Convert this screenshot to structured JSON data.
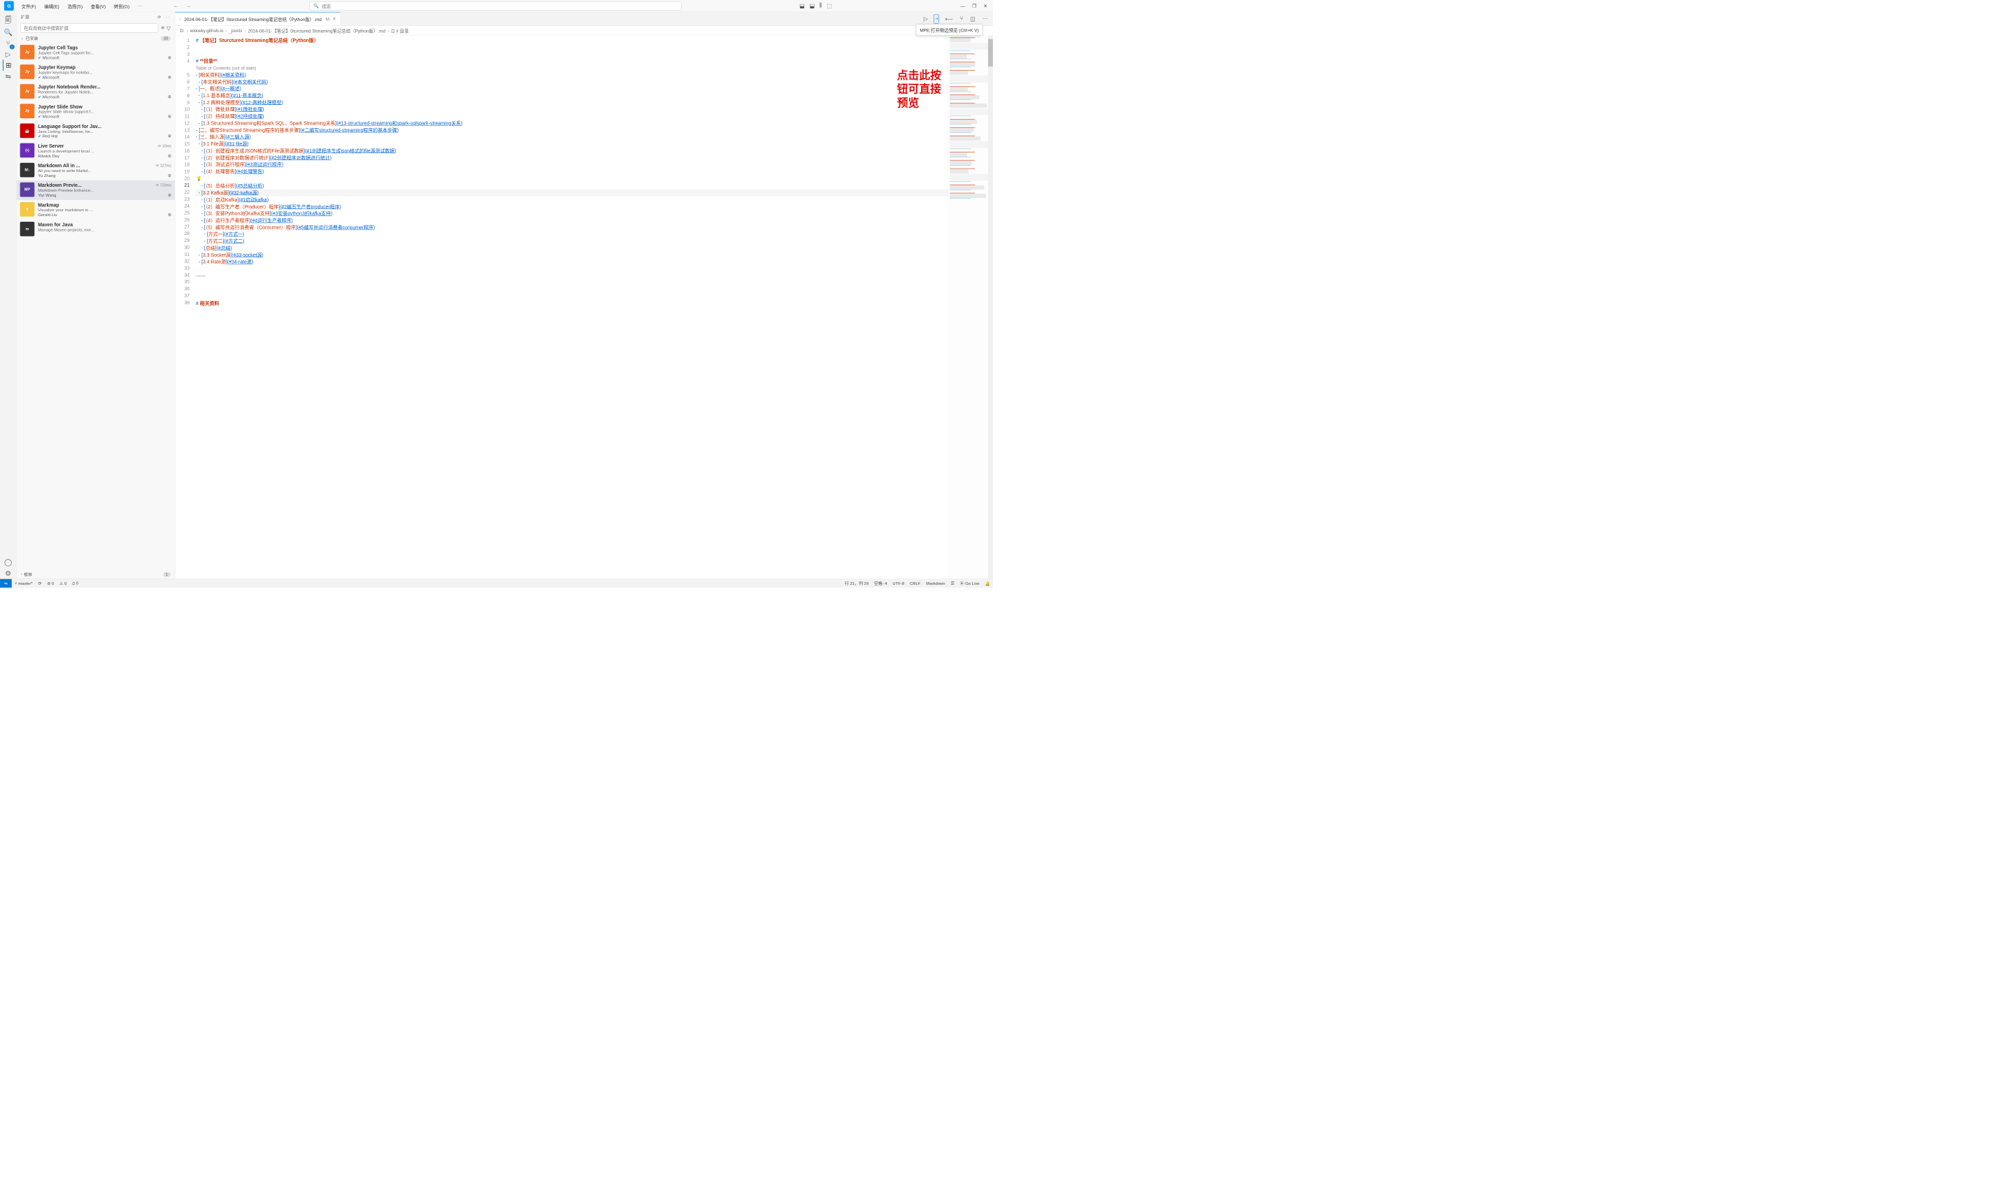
{
  "menu": [
    "文件(F)",
    "编辑(E)",
    "选择(S)",
    "查看(V)",
    "转到(G)",
    "···"
  ],
  "search_placeholder": "搜索",
  "titlebar_layouts": [
    "⬓",
    "⬓",
    "⫼",
    "⬚"
  ],
  "win_controls": [
    "—",
    "❐",
    "✕"
  ],
  "activity_icons": [
    {
      "name": "files-icon",
      "glyph": "🗐"
    },
    {
      "name": "search-icon",
      "glyph": "🔍"
    },
    {
      "name": "scm-icon",
      "glyph": "⑂",
      "badge": "1"
    },
    {
      "name": "debug-icon",
      "glyph": "▷"
    },
    {
      "name": "extensions-icon",
      "glyph": "⊞",
      "active": true
    },
    {
      "name": "remote-icon",
      "glyph": "⇋"
    }
  ],
  "activity_bottom": [
    {
      "name": "account-icon",
      "glyph": "◯"
    },
    {
      "name": "settings-icon",
      "glyph": "⚙"
    }
  ],
  "sidebar": {
    "title": "扩展",
    "search_placeholder": "在应用商店中搜索扩展",
    "installed_label": "已安装",
    "installed_count": "33",
    "recommended_label": "推荐",
    "recommended_count": "1",
    "items": [
      {
        "name": "Jupyter Cell Tags",
        "desc": "Jupyter Cell Tags support for...",
        "publisher": "Microsoft",
        "verified": true,
        "color": "#f37726",
        "icon": "Jy",
        "gear": true,
        "truncated": true
      },
      {
        "name": "Jupyter Keymap",
        "desc": "Jupyter keymaps for notebo...",
        "publisher": "Microsoft",
        "verified": true,
        "color": "#f37726",
        "icon": "Jy",
        "gear": true
      },
      {
        "name": "Jupyter Notebook Render...",
        "desc": "Renderers for Jupyter Noteb...",
        "publisher": "Microsoft",
        "verified": true,
        "color": "#f37726",
        "icon": "Jy",
        "gear": true
      },
      {
        "name": "Jupyter Slide Show",
        "desc": "Jupyter Slide Show support f...",
        "publisher": "Microsoft",
        "verified": true,
        "color": "#f37726",
        "icon": "Jy",
        "gear": true
      },
      {
        "name": "Language Support for Jav...",
        "desc": "Java Linting, Intellisense, for...",
        "publisher": "Red Hat",
        "verified": true,
        "color": "#cc0000",
        "icon": "☕",
        "gear": true
      },
      {
        "name": "Live Server",
        "desc": "Launch a development local ...",
        "publisher": "Ritwick Dey",
        "verified": false,
        "color": "#6c2eb9",
        "icon": "(•)",
        "time": "⟳ 10ms",
        "gear": true
      },
      {
        "name": "Markdown All in ...",
        "desc": "All you need to write Markd...",
        "publisher": "Yu Zhang",
        "verified": false,
        "color": "#333",
        "icon": "M↓",
        "time": "⟳ 127ms",
        "gear": true
      },
      {
        "name": "Markdown Previe...",
        "desc": "Markdown Preview Enhance...",
        "publisher": "Yiyi Wang",
        "verified": false,
        "color": "#5a3ea0",
        "icon": "MP",
        "time": "⟳ 733ms",
        "selected": true,
        "gear": true
      },
      {
        "name": "Markmap",
        "desc": "Visualize your markdown in ...",
        "publisher": "Gerald Liu",
        "verified": false,
        "color": "#f5c842",
        "icon": "⟡",
        "gear": true
      },
      {
        "name": "Maven for Java",
        "desc": "Manage Maven projects, exe...",
        "publisher": "",
        "verified": false,
        "color": "#333",
        "icon": "m"
      }
    ]
  },
  "tab": {
    "filename": "2024-06-01-【笔记】Sturctured Streaming笔记总结（Python版）.md",
    "modified": "M"
  },
  "tooltip": "MPE:打开侧边预览 (Ctrl+K V)",
  "breadcrumb": [
    "D:",
    "wkkwky.github.io",
    "_posts",
    "2024-06-01-【笔记】Sturctured Streaming笔记总结（Python版）.md",
    "⊡ # 目录"
  ],
  "annotation": "点击此按\n钮可直接\n预览",
  "code_lines": [
    {
      "n": 1,
      "html": "<span class='punc'>#</span> <span class='h1'>【笔记】Sturctured Streaming笔记总结（Python版）</span>"
    },
    {
      "n": 2,
      "html": ""
    },
    {
      "n": 3,
      "html": ""
    },
    {
      "n": 4,
      "html": "<span class='punc'>#</span> <span class='h1'>**目录**</span>"
    },
    {
      "n": 0,
      "html": "<span class='toc-note'>Table of Contents (out of date)</span>"
    },
    {
      "n": 5,
      "html": "<span class='punc'>-</span> <span class='lbracket'>[</span><span class='linktext'>相关资料</span><span class='lbracket'>](</span><span class='anchor'>#相关资料</span><span class='lbracket'>)</span>"
    },
    {
      "n": 6,
      "html": "  <span class='punc'>-</span> <span class='lbracket'>[</span><span class='linktext'>本文相关代码</span><span class='lbracket'>](</span><span class='anchor'>#本文相关代码</span><span class='lbracket'>)</span>"
    },
    {
      "n": 7,
      "html": "<span class='punc'>-</span> <span class='lbracket'>[</span><span class='linktext'>一、概述</span><span class='lbracket'>](</span><span class='anchor'>#一概述</span><span class='lbracket'>)</span>"
    },
    {
      "n": 8,
      "html": "  <span class='punc'>-</span> <span class='lbracket'>[</span><span class='linktext'>1.1 基本概念</span><span class='lbracket'>](</span><span class='anchor'>#11-基本概念</span><span class='lbracket'>)</span>"
    },
    {
      "n": 9,
      "html": "  <span class='punc'>-</span> <span class='lbracket'>[</span><span class='linktext'>1.2 两种处理模型</span><span class='lbracket'>](</span><span class='anchor'>#12-两种处理模型</span><span class='lbracket'>)</span>"
    },
    {
      "n": 10,
      "html": "    <span class='punc'>-</span> <span class='lbracket'>[</span><span class='linktext'>（1）微批处理</span><span class='lbracket'>](</span><span class='anchor'>#1微批处理</span><span class='lbracket'>)</span>"
    },
    {
      "n": 11,
      "html": "    <span class='punc'>-</span> <span class='lbracket'>[</span><span class='linktext'>（2）持续处理</span><span class='lbracket'>](</span><span class='anchor'>#2持续处理</span><span class='lbracket'>)</span>"
    },
    {
      "n": 12,
      "html": "  <span class='punc'>-</span> <span class='lbracket'>[</span><span class='linktext'>1.3 Structured Streaming和Spark SQL、Spark Streaming关系</span><span class='lbracket'>](</span><span class='anchor'>#13-structured-streaming和spark-sqlspark-streaming关系</span><span class='lbracket'>)</span>"
    },
    {
      "n": 13,
      "html": "<span class='punc'>-</span> <span class='lbracket'>[</span><span class='linktext'>二、编写Structured Streaming程序的基本步骤</span><span class='lbracket'>](</span><span class='anchor'>#二编写structured-streaming程序的基本步骤</span><span class='lbracket'>)</span>"
    },
    {
      "n": 14,
      "html": "<span class='punc'>-</span> <span class='lbracket'>[</span><span class='linktext'>三、输入源</span><span class='lbracket'>](</span><span class='anchor'>#三输入源</span><span class='lbracket'>)</span>"
    },
    {
      "n": 15,
      "html": "  <span class='punc'>-</span> <span class='lbracket'>[</span><span class='linktext'>3.1 File源</span><span class='lbracket'>](</span><span class='anchor'>#31-file源</span><span class='lbracket'>)</span>"
    },
    {
      "n": 16,
      "html": "    <span class='punc'>-</span> <span class='lbracket'>[</span><span class='linktext'>（1）创建程序生成JSON格式的File源测试数据</span><span class='lbracket'>](</span><span class='anchor'>#1创建程序生成json格式的file源测试数据</span><span class='lbracket'>)</span>"
    },
    {
      "n": 17,
      "html": "    <span class='punc'>-</span> <span class='lbracket'>[</span><span class='linktext'>（2）创建程序对数据进行统计</span><span class='lbracket'>](</span><span class='anchor'>#2创建程序对数据进行统计</span><span class='lbracket'>)</span>"
    },
    {
      "n": 18,
      "html": "    <span class='punc'>-</span> <span class='lbracket'>[</span><span class='linktext'>（3）测试运行程序</span><span class='lbracket'>](</span><span class='anchor'>#3测试运行程序</span><span class='lbracket'>)</span>"
    },
    {
      "n": 19,
      "html": "    <span class='punc'>-</span> <span class='lbracket'>[</span><span class='linktext'>（4）处理警告</span><span class='lbracket'>](</span><span class='anchor'>#4处理警告</span><span class='lbracket'>)</span>"
    },
    {
      "n": 20,
      "html": "    <span class='punc'>-</span> <span class='lbracket'>[</span><span class='linktext'>（5）总结分析</span><span class='lbracket'>](</span><span class='anchor'>#5总结分析</span><span class='lbracket'>)</span>",
      "bulb": true
    },
    {
      "n": 21,
      "html": "  <span class='punc'>-</span> <span class='lbracket'>[</span><span class='linktext'>3.2 Kafka源</span><span class='lbracket'>](</span><span class='anchor'>#32-kafka源</span><span class='lbracket'>)</span>",
      "current": true
    },
    {
      "n": 22,
      "html": "    <span class='punc'>-</span> <span class='lbracket'>[</span><span class='linktext'>（1）启动Kafka</span><span class='lbracket'>](</span><span class='anchor'>#1启动kafka</span><span class='lbracket'>)</span>"
    },
    {
      "n": 23,
      "html": "    <span class='punc'>-</span> <span class='lbracket'>[</span><span class='linktext'>（2）编写生产者（Producer）程序</span><span class='lbracket'>](</span><span class='anchor'>#2编写生产者producer程序</span><span class='lbracket'>)</span>"
    },
    {
      "n": 24,
      "html": "    <span class='punc'>-</span> <span class='lbracket'>[</span><span class='linktext'>（3）安装Python3的Kafka支持</span><span class='lbracket'>](</span><span class='anchor'>#3安装python3的kafka支持</span><span class='lbracket'>)</span>"
    },
    {
      "n": 25,
      "html": "    <span class='punc'>-</span> <span class='lbracket'>[</span><span class='linktext'>（4）运行生产者程序</span><span class='lbracket'>](</span><span class='anchor'>#4运行生产者程序</span><span class='lbracket'>)</span>"
    },
    {
      "n": 26,
      "html": "    <span class='punc'>-</span> <span class='lbracket'>[</span><span class='linktext'>（5）编写并运行消费者（Consumer）程序</span><span class='lbracket'>](</span><span class='anchor'>#5编写并运行消费者consumer程序</span><span class='lbracket'>)</span>"
    },
    {
      "n": 27,
      "html": "      <span class='punc'>-</span> <span class='lbracket'>[</span><span class='linktext'>方式一</span><span class='lbracket'>](</span><span class='anchor'>#方式一</span><span class='lbracket'>)</span>"
    },
    {
      "n": 28,
      "html": "      <span class='punc'>-</span> <span class='lbracket'>[</span><span class='linktext'>方式二</span><span class='lbracket'>](</span><span class='anchor'>#方式二</span><span class='lbracket'>)</span>"
    },
    {
      "n": 29,
      "html": "    <span class='punc'>-</span> <span class='lbracket'>[</span><span class='linktext'>总结</span><span class='lbracket'>](</span><span class='anchor'>#总结</span><span class='lbracket'>)</span>"
    },
    {
      "n": 30,
      "html": "  <span class='punc'>-</span> <span class='lbracket'>[</span><span class='linktext'>3.3 Socket源</span><span class='lbracket'>](</span><span class='anchor'>#33-socket源</span><span class='lbracket'>)</span>"
    },
    {
      "n": 31,
      "html": "  <span class='punc'>-</span> <span class='lbracket'>[</span><span class='linktext'>3.4 Rate源</span><span class='lbracket'>](</span><span class='anchor'>#34-rate源</span><span class='lbracket'>)</span>"
    },
    {
      "n": 32,
      "html": ""
    },
    {
      "n": 33,
      "html": "<span class='sep-dash'>------</span>"
    },
    {
      "n": 34,
      "html": ""
    },
    {
      "n": 35,
      "html": ""
    },
    {
      "n": 36,
      "html": ""
    },
    {
      "n": 37,
      "html": "<span class='punc'>#</span> <span class='h1'>相关资料</span>"
    },
    {
      "n": 38,
      "html": ""
    }
  ],
  "statusbar": {
    "branch": "master*",
    "sync": "⟳",
    "errors": "⊘ 0",
    "warnings": "⚠ 0",
    "ports": "⩍ 0",
    "cursor": "行 21，列 29",
    "spaces": "空格: 4",
    "encoding": "UTF-8",
    "eol": "CRLF",
    "lang": "Markdown",
    "golive": "⦿ Go Live",
    "bell": "🔔"
  },
  "tab_actions": [
    {
      "name": "run-icon",
      "glyph": "▷"
    },
    {
      "name": "preview-side-icon",
      "glyph": "⫞",
      "highlighted": true
    },
    {
      "name": "preview-icon",
      "glyph": "⟵"
    },
    {
      "name": "diff-icon",
      "glyph": "⑂"
    },
    {
      "name": "split-icon",
      "glyph": "◫"
    },
    {
      "name": "more-icon",
      "glyph": "···"
    }
  ]
}
